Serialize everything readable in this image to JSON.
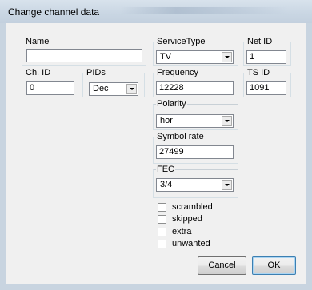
{
  "window": {
    "title": "Change channel data"
  },
  "fields": {
    "name": {
      "label": "Name",
      "value": ""
    },
    "service_type": {
      "label": "ServiceType",
      "value": "TV"
    },
    "net_id": {
      "label": "Net ID",
      "value": "1"
    },
    "ch_id": {
      "label": "Ch. ID",
      "value": "0"
    },
    "pids": {
      "label": "PIDs",
      "value": "Dec"
    },
    "frequency": {
      "label": "Frequency",
      "value": "12228"
    },
    "ts_id": {
      "label": "TS ID",
      "value": "1091"
    },
    "polarity": {
      "label": "Polarity",
      "value": "hor"
    },
    "symbol_rate": {
      "label": "Symbol rate",
      "value": "27499"
    },
    "fec": {
      "label": "FEC",
      "value": "3/4"
    }
  },
  "checkboxes": [
    {
      "label": "scrambled",
      "checked": false
    },
    {
      "label": "skipped",
      "checked": false
    },
    {
      "label": "extra",
      "checked": false
    },
    {
      "label": "unwanted",
      "checked": false
    }
  ],
  "buttons": {
    "cancel": "Cancel",
    "ok": "OK"
  }
}
